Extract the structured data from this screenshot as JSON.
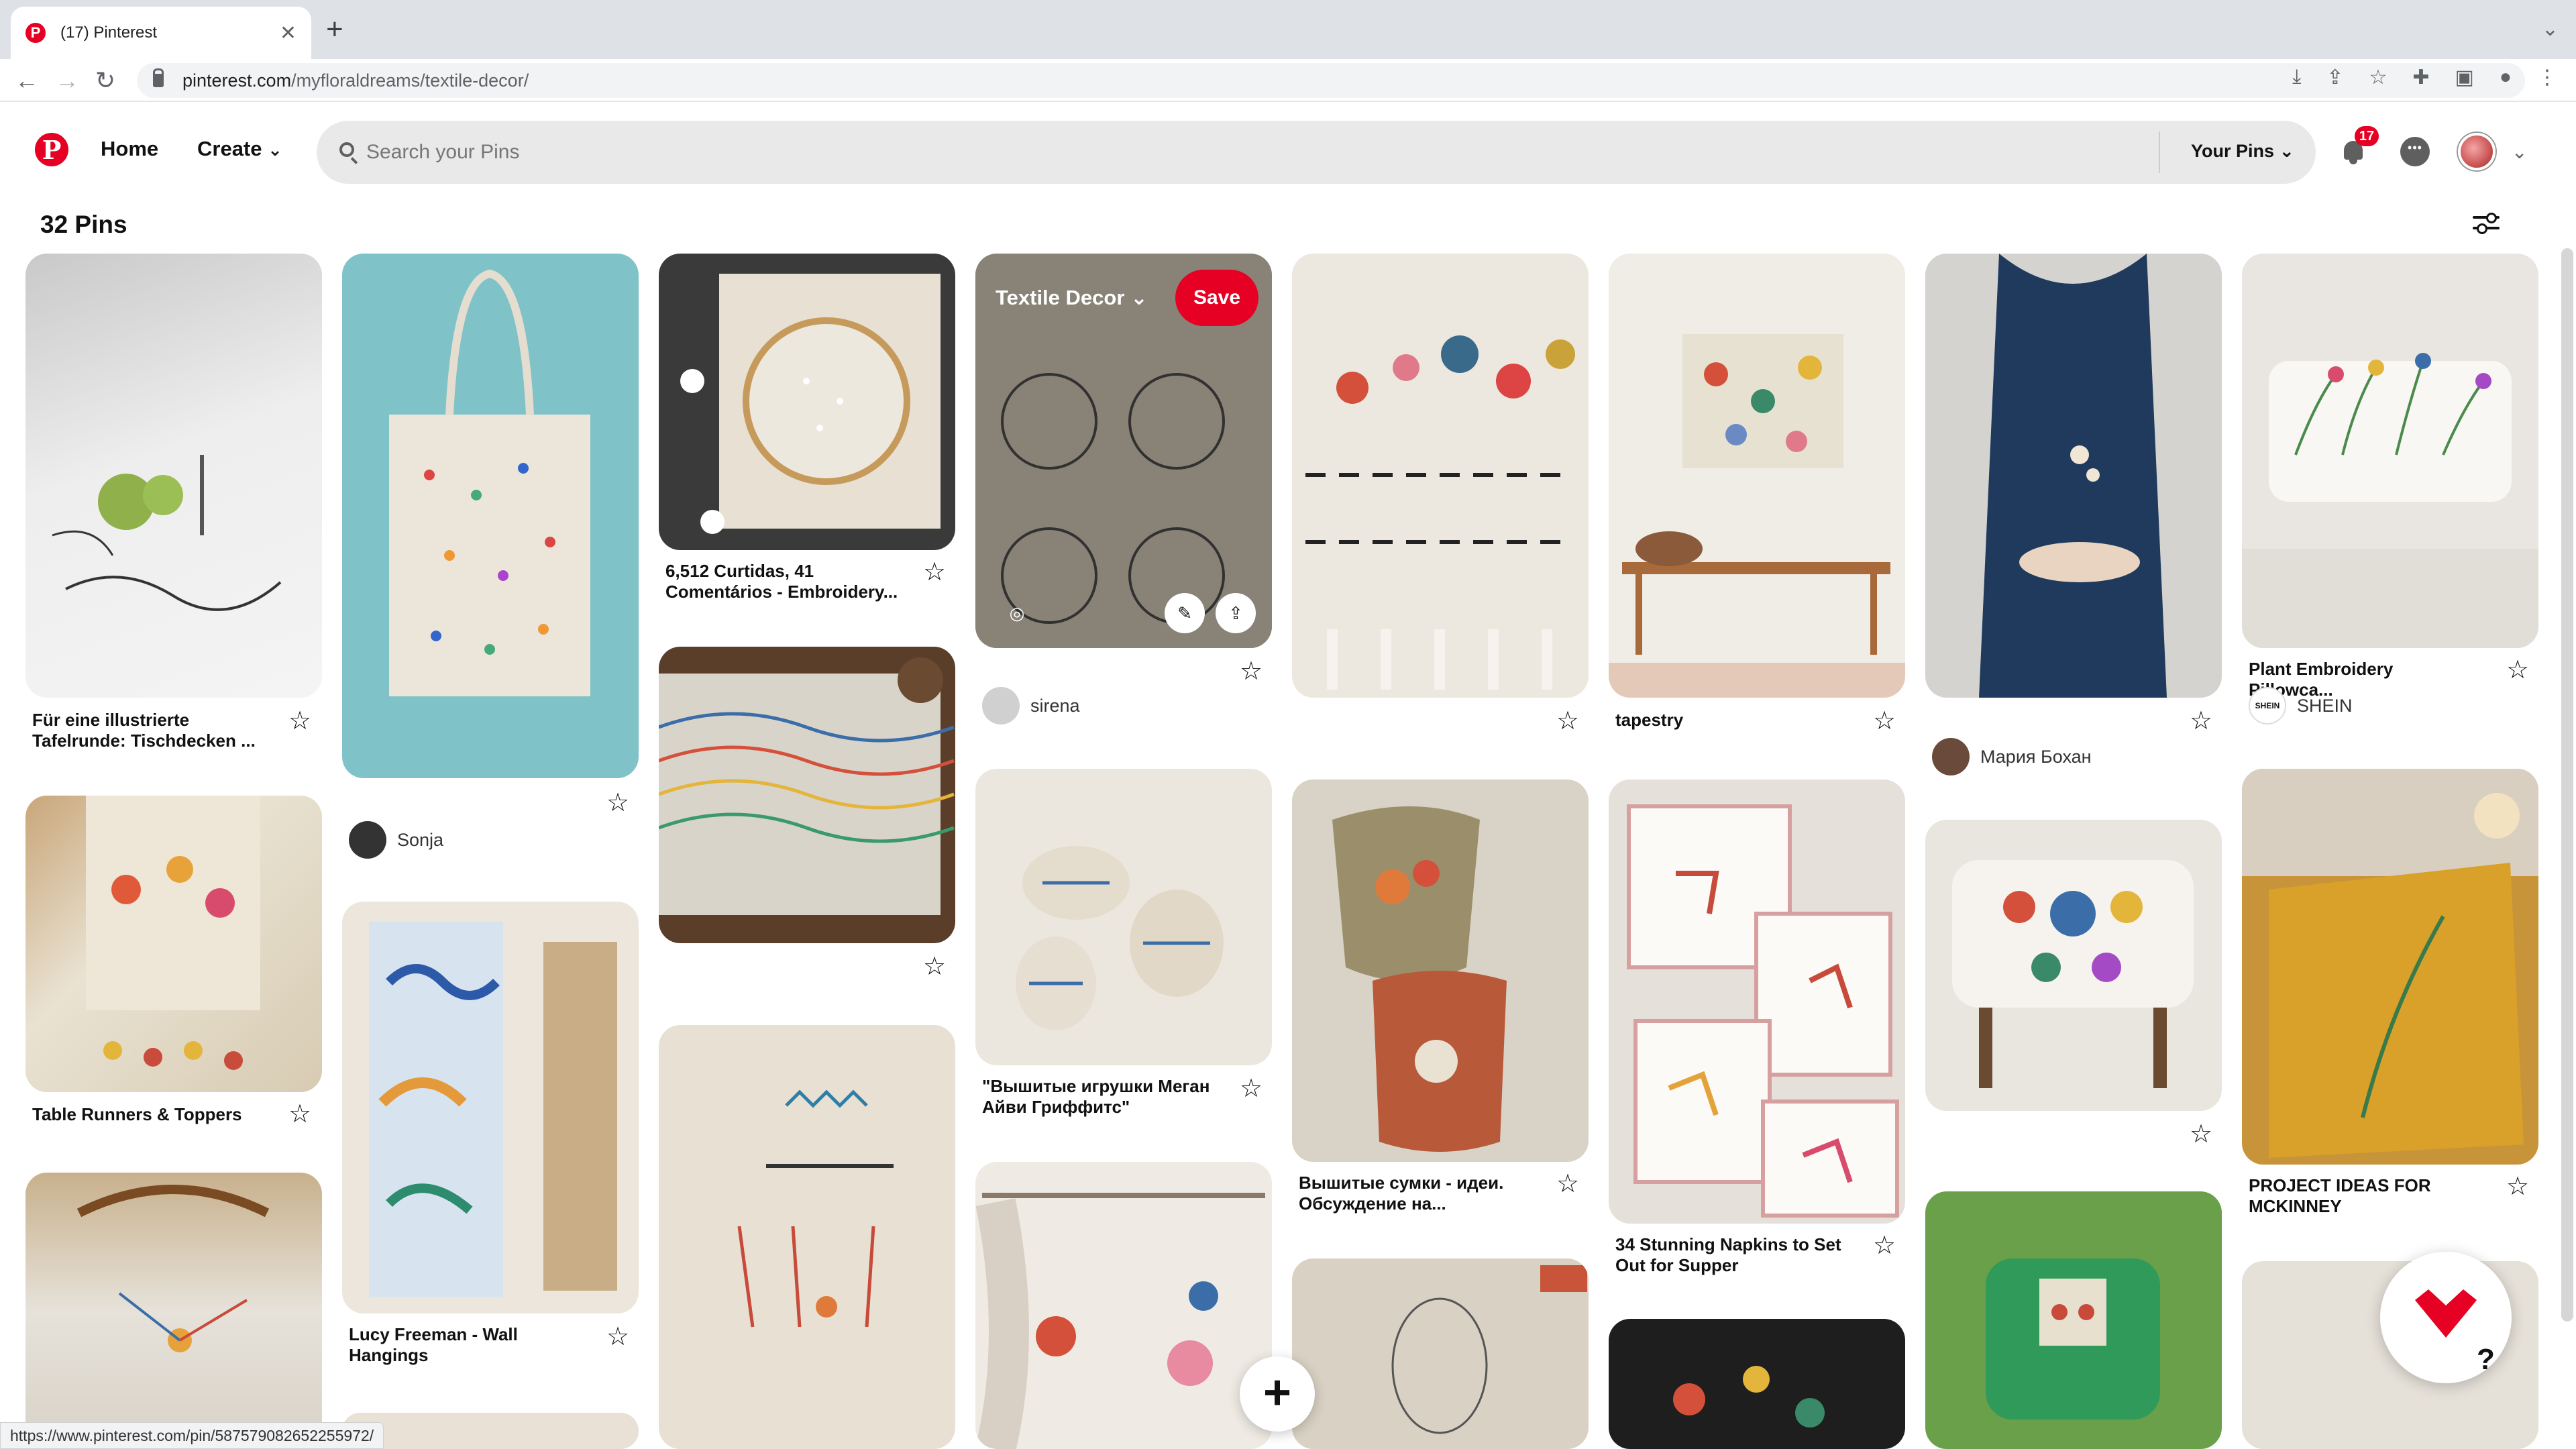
{
  "browser": {
    "tab_title": "(17) Pinterest",
    "tab_close": "✕",
    "new_tab": "+",
    "url_domain": "pinterest.com",
    "url_path": "/myfloraldreams/textile-decor/",
    "status_url": "https://www.pinterest.com/pin/587579082652255972/"
  },
  "header": {
    "home_label": "Home",
    "create_label": "Create",
    "search_placeholder": "Search your Pins",
    "your_pins_label": "Your Pins",
    "notification_count": "17"
  },
  "board": {
    "pins_count": "32 Pins"
  },
  "hover_pin": {
    "board_label": "Textile Decor",
    "save_label": "Save"
  },
  "pins": [
    {
      "title": "Für eine illustrierte Tafelrunde: Tischdecken ..."
    },
    {
      "user": "Sonja"
    },
    {
      "title": "6,512 Curtidas, 41 Comentários - Embroidery..."
    },
    {
      "user": "sirena"
    },
    {
      "title": "tapestry"
    },
    {
      "user": "Мария Бохан"
    },
    {
      "title": "Plant Embroidery Pillowca...",
      "user": "SHEIN",
      "user_logo": "SHEIN"
    },
    {
      "title": "Table Runners & Toppers"
    },
    {
      "title": "Lucy Freeman - Wall Hangings"
    },
    {
      "title": "\"Вышитые игрушки Меган Айви Гриффитс\""
    },
    {
      "title": "Вышитые сумки - идеи. Обсуждение на..."
    },
    {
      "title": "34 Stunning Napkins to Set Out for Supper"
    },
    {
      "title": "PROJECT IDEAS FOR MCKINNEY"
    }
  ],
  "colors": {
    "brand_red": "#e60023",
    "search_bg": "#e9e9e9"
  }
}
